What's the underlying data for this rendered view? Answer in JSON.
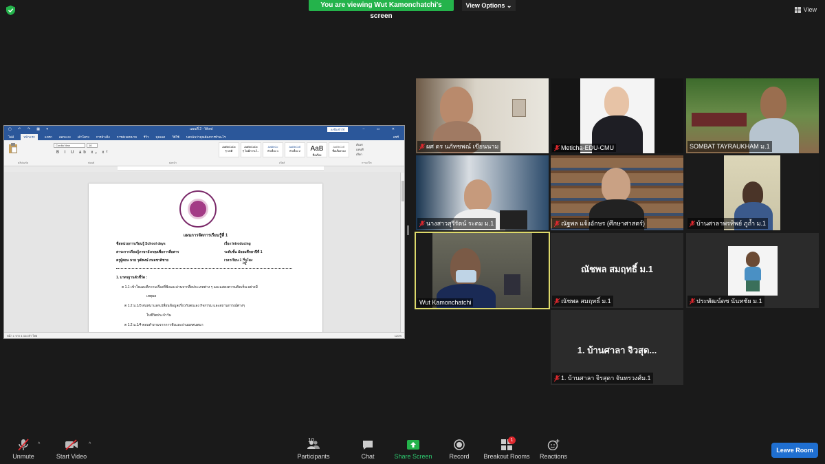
{
  "top": {
    "banner": "You are viewing Wut Kamonchatchi's screen",
    "view_options": "View Options",
    "view": "View"
  },
  "word": {
    "quick_access": "▢ ↶ ↷ ▦ ▾",
    "title": "แผนที่ 2 - Word",
    "sign_in": "ลงชื่อเข้าใช้",
    "window_buttons": "– ▭ ✕",
    "menu": [
      "ไฟล์",
      "หน้าแรก",
      "แทรก",
      "ออกแบบ",
      "เค้าโครง",
      "การอ้างอิง",
      "การส่งจดหมาย",
      "รีวิว",
      "มุมมอง",
      "วิธีใช้",
      "บอกฉันว่าคุณต้องการทำอะไร"
    ],
    "share": "แชร์",
    "font": "Cordia New",
    "size": "16",
    "formatting": "B I U ab x₂ x²",
    "styles": [
      {
        "preview": "AaBbCcDc",
        "name": "¶ ปกติ"
      },
      {
        "preview": "AaBbCcDc",
        "name": "¶ ไม่มีการเว้..."
      },
      {
        "preview": "AaBbCc",
        "name": "หัวเรื่อง 1"
      },
      {
        "preview": "AaBbCcE",
        "name": "หัวเรื่อง 2"
      },
      {
        "preview": "AaB",
        "name": "ชื่อเรื่อง"
      },
      {
        "preview": "AaBbCcE",
        "name": "ชื่อเรื่องรอง"
      }
    ],
    "groups": [
      "คลิปบอร์ด",
      "ฟอนต์",
      "ย่อหน้า",
      "สไตล์",
      "การแก้ไข"
    ],
    "editing": [
      "ค้นหา",
      "แทนที่",
      "เลือก"
    ],
    "document": {
      "title": "แผนการจัดการเรียนรู้ที่ 1",
      "rows": [
        {
          "left": "ชื่อหน่วยการเรียนรู้ School days",
          "right": "เรื่อง Introducing"
        },
        {
          "left": "สาระการเรียนรู้ภาษาอังกฤษเพื่อการสื่อสาร",
          "right": "ระดับชั้น มัธยมศึกษาปีที่ 1"
        },
        {
          "left": "ครูผู้สอน นาย วุฒิพงษ์ กมลชาติชาย",
          "right": "เวลาเรียน 1 ชั่วโมง"
        }
      ],
      "section": "1. มาตรฐานตัวชี้วัด :",
      "items": [
        "ต 1.1  เข้าใจและตีความเรื่องที่ฟังและอ่านจากสื่อประเภทต่าง ๆ และแสดงความคิดเห็น อย่างมี",
        "เหตุผล",
        "ต 1.2 ม.1/3  สนทนาแลกเปลี่ยนข้อมูลเกี่ยวกับตนเอง กิจกรรม และสถานการณ์ต่างๆ",
        "ในชีวิตประจำวัน",
        "ต 1.2 ม.1/4 ตอบคำถามจากการฟังและอ่านบทสนทนา"
      ]
    },
    "status_left": "หน้า 1 จาก 4     344 คำ     ไทย",
    "status_zoom": "120%"
  },
  "participants": [
    {
      "name": "ผศ ดร นภัทชพณ์ เขียนนาม",
      "muted": true
    },
    {
      "name": "Meticha-EDU-CMU",
      "muted": true
    },
    {
      "name": "SOMBAT TAYRAUKHAM ม.1",
      "muted": false
    },
    {
      "name": "นางสาวสุรีรัตน์ ระดม ม.1",
      "muted": true
    },
    {
      "name": "ณัฐพล แจ้งอักษร (ศึกษาศาสตร์)",
      "muted": true
    },
    {
      "name": "บ้านศาลาพรทิพย์ ภูถ้ำ ม.1",
      "muted": true
    },
    {
      "name": "Wut Kamonchatchi",
      "muted": false
    },
    {
      "name": "ณัชพล สมฤทธิ์ ม.1",
      "big": "ณัชพล สมฤทธิ์ ม.1",
      "muted": true
    },
    {
      "name": "ประพัฒน์ดช นันทชัย ม.1",
      "muted": true
    },
    {
      "name": "1. บ้านศาลา จิรสุดา จันทรวงศ์ม.1",
      "big": "1. บ้านศาลา จิวสุด...",
      "muted": true
    }
  ],
  "toolbar": {
    "unmute": "Unmute",
    "start_video": "Start Video",
    "participants": "Participants",
    "participant_count": "10",
    "chat": "Chat",
    "share_screen": "Share Screen",
    "record": "Record",
    "breakout_rooms": "Breakout Rooms",
    "breakout_badge": "1",
    "reactions": "Reactions",
    "leave_room": "Leave Room"
  },
  "colors": {
    "banner_green": "#24b34b",
    "leave_blue": "#1f6fd1",
    "active_speaker": "#ddd96a",
    "share_green": "#2ecc71",
    "word_blue": "#2b579a",
    "mute_red": "#e0282e"
  }
}
